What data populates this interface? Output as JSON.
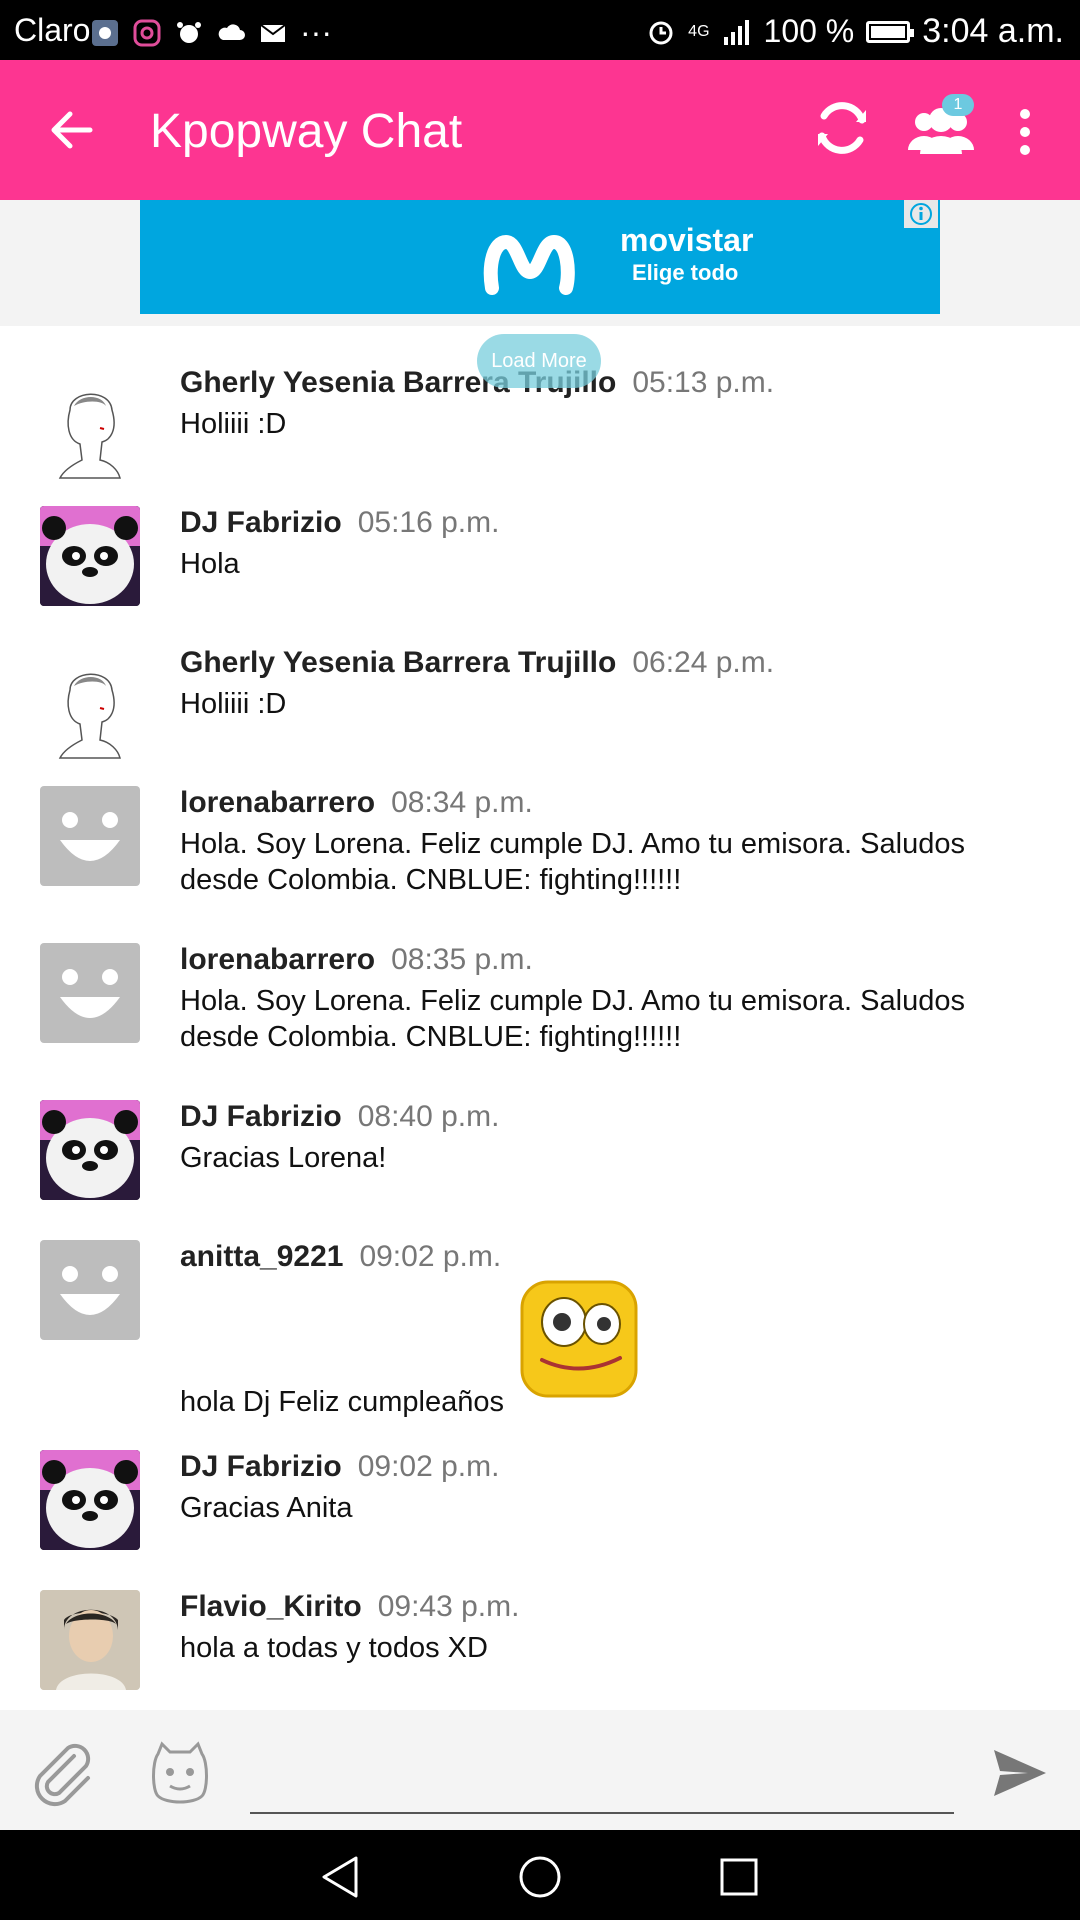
{
  "status_bar": {
    "carrier": "Claro",
    "more": "···",
    "network": "4G",
    "battery": "100 %",
    "time": "3:04 a.m."
  },
  "app_bar": {
    "title": "Kpopway Chat",
    "users_badge": "1"
  },
  "ad": {
    "brand": "movistar",
    "tagline": "Elige todo"
  },
  "load_more_label": "Load More",
  "messages": [
    {
      "sender": "Gherly Yesenia Barrera Trujillo",
      "time": "05:13 p.m.",
      "text": "Holiiii :D",
      "avatar": "sketch-avatar"
    },
    {
      "sender": "DJ Fabrizio",
      "time": "05:16 p.m.",
      "text": "Hola",
      "avatar": "panda-avatar"
    },
    {
      "sender": "Gherly Yesenia Barrera Trujillo",
      "time": "06:24 p.m.",
      "text": "Holiiii :D",
      "avatar": "sketch-avatar"
    },
    {
      "sender": "lorenabarrero",
      "time": "08:34 p.m.",
      "text": "Hola. Soy Lorena. Feliz cumple DJ. Amo tu emisora. Saludos desde Colombia. CNBLUE: fighting!!!!!!",
      "avatar": "default-avatar"
    },
    {
      "sender": "lorenabarrero",
      "time": "08:35 p.m.",
      "text": "Hola. Soy Lorena. Feliz cumple DJ. Amo tu emisora. Saludos desde Colombia. CNBLUE: fighting!!!!!!",
      "avatar": "default-avatar"
    },
    {
      "sender": "DJ Fabrizio",
      "time": "08:40 p.m.",
      "text": "Gracias Lorena!",
      "avatar": "panda-avatar"
    },
    {
      "sender": "anitta_9221",
      "time": "09:02 p.m.",
      "text": "hola Dj Feliz cumpleaños",
      "avatar": "default-avatar",
      "emoji": "goofy-face-emoji"
    },
    {
      "sender": "DJ Fabrizio",
      "time": "09:02 p.m.",
      "text": "Gracias Anita",
      "avatar": "panda-avatar"
    },
    {
      "sender": "Flavio_Kirito",
      "time": "09:43 p.m.",
      "text": "hola a todas y todos XD",
      "avatar": "photo-avatar"
    }
  ],
  "input": {
    "value": "",
    "placeholder": ""
  },
  "colors": {
    "app_bar": "#fd3591",
    "ad_background": "#00a6df",
    "load_more": "#78cddc",
    "badge": "#6cc9e0"
  }
}
